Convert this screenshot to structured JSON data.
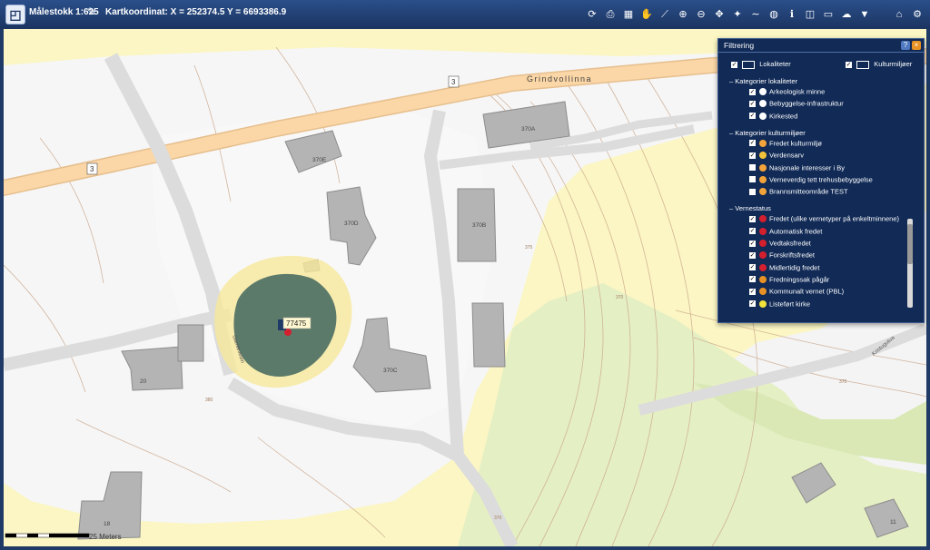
{
  "toolbar": {
    "scale": "Målestokk 1:625",
    "coords": "Kartkoordinat: X = 252374.5  Y = 6693386.9",
    "tools": [
      "refresh-icon",
      "print-icon",
      "map-icon",
      "hand-icon",
      "measure-icon",
      "zoom-in-icon",
      "zoom-out-icon",
      "pan-icon",
      "star-icon",
      "line-icon",
      "globe-icon",
      "info-icon",
      "layers-icon",
      "ruler-icon",
      "cloud-icon",
      "filter-icon",
      "home-icon",
      "settings-icon"
    ]
  },
  "map": {
    "road_name": "Grindvollinna",
    "road_number": "3",
    "local_road": "Gamleveien",
    "local_road_2": "Kristugutua",
    "buildings": [
      "370E",
      "370A",
      "370D",
      "370B",
      "370C",
      "20",
      "18",
      "11"
    ],
    "contours": [
      "380",
      "370",
      "375",
      "370",
      "370"
    ],
    "site_id": "77475",
    "scalebar": "25 Meters"
  },
  "panel": {
    "title": "Filtrering",
    "top": [
      "Lokaliteter",
      "Kulturmiljøer"
    ],
    "sections": [
      {
        "title": "Kategorier lokaliteter",
        "items": [
          {
            "label": "Arkeologisk minne",
            "checked": true,
            "color": "#ffffff"
          },
          {
            "label": "Bebyggelse-Infrastruktur",
            "checked": true,
            "color": "#ffffff"
          },
          {
            "label": "Kirkested",
            "checked": true,
            "color": "#ffffff"
          }
        ]
      },
      {
        "title": "Kategorier kulturmiljøer",
        "items": [
          {
            "label": "Fredet kulturmiljø",
            "checked": true,
            "color": "#f2a33a"
          },
          {
            "label": "Verdensarv",
            "checked": true,
            "color": "#f2c23a"
          },
          {
            "label": "Nasjonale interesser i By",
            "checked": false,
            "color": "#f2a33a"
          },
          {
            "label": "Verneverdig tett trehusbebyggelse",
            "checked": false,
            "color": "#f2a33a"
          },
          {
            "label": "Brannsmitteområde TEST",
            "checked": false,
            "color": "#f2a33a"
          }
        ]
      },
      {
        "title": "Vernestatus",
        "items": [
          {
            "label": "Fredet (ulike vernetyper på enkeltminnene)",
            "checked": true,
            "color": "#d41f2e"
          },
          {
            "label": "Automatisk fredet",
            "checked": true,
            "color": "#d41f2e"
          },
          {
            "label": "Vedtaksfredet",
            "checked": true,
            "color": "#d41f2e"
          },
          {
            "label": "Forskriftsfredet",
            "checked": true,
            "color": "#d41f2e"
          },
          {
            "label": "Midlertidig fredet",
            "checked": true,
            "color": "#d41f2e"
          },
          {
            "label": "Fredningssak pågår",
            "checked": true,
            "color": "#e89124"
          },
          {
            "label": "Kommunalt vernet (PBL)",
            "checked": true,
            "color": "#e89124"
          },
          {
            "label": "Listeført kirke",
            "checked": true,
            "color": "#f2e33a"
          }
        ]
      }
    ]
  }
}
